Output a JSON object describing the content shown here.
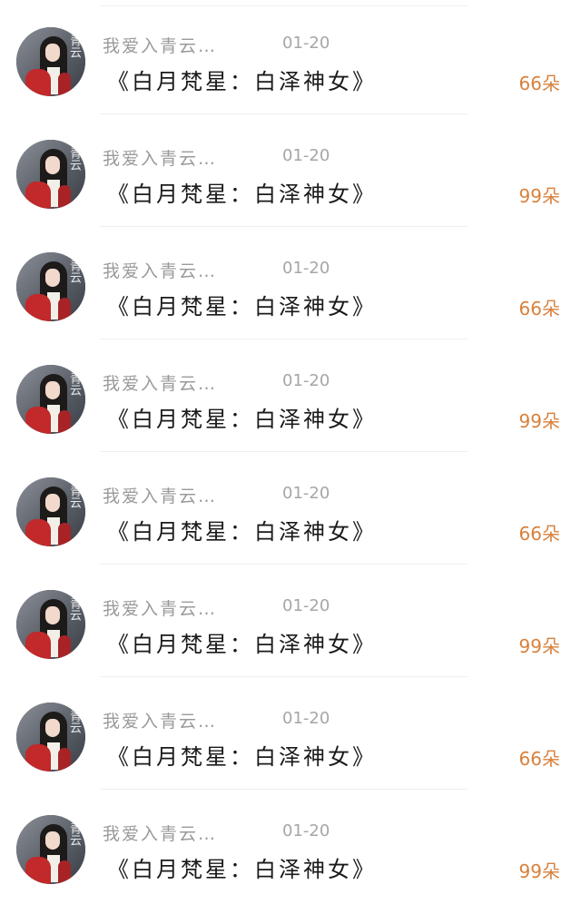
{
  "gifts": [
    {
      "sender": "我爱入青云…",
      "date": "01-20",
      "gift_name": "《白月梵星：白泽神女》",
      "amount": "66朵"
    },
    {
      "sender": "我爱入青云…",
      "date": "01-20",
      "gift_name": "《白月梵星：白泽神女》",
      "amount": "99朵"
    },
    {
      "sender": "我爱入青云…",
      "date": "01-20",
      "gift_name": "《白月梵星：白泽神女》",
      "amount": "66朵"
    },
    {
      "sender": "我爱入青云…",
      "date": "01-20",
      "gift_name": "《白月梵星：白泽神女》",
      "amount": "99朵"
    },
    {
      "sender": "我爱入青云…",
      "date": "01-20",
      "gift_name": "《白月梵星：白泽神女》",
      "amount": "66朵"
    },
    {
      "sender": "我爱入青云…",
      "date": "01-20",
      "gift_name": "《白月梵星：白泽神女》",
      "amount": "99朵"
    },
    {
      "sender": "我爱入青云…",
      "date": "01-20",
      "gift_name": "《白月梵星：白泽神女》",
      "amount": "66朵"
    },
    {
      "sender": "我爱入青云…",
      "date": "01-20",
      "gift_name": "《白月梵星：白泽神女》",
      "amount": "99朵"
    }
  ],
  "avatar": {
    "calligraphy": "青云"
  },
  "colors": {
    "amount": "#d8813c",
    "sender": "#9a9a9a",
    "date": "#a6a6a6",
    "gift_name": "#1a1a1a",
    "divider": "#efefef"
  }
}
